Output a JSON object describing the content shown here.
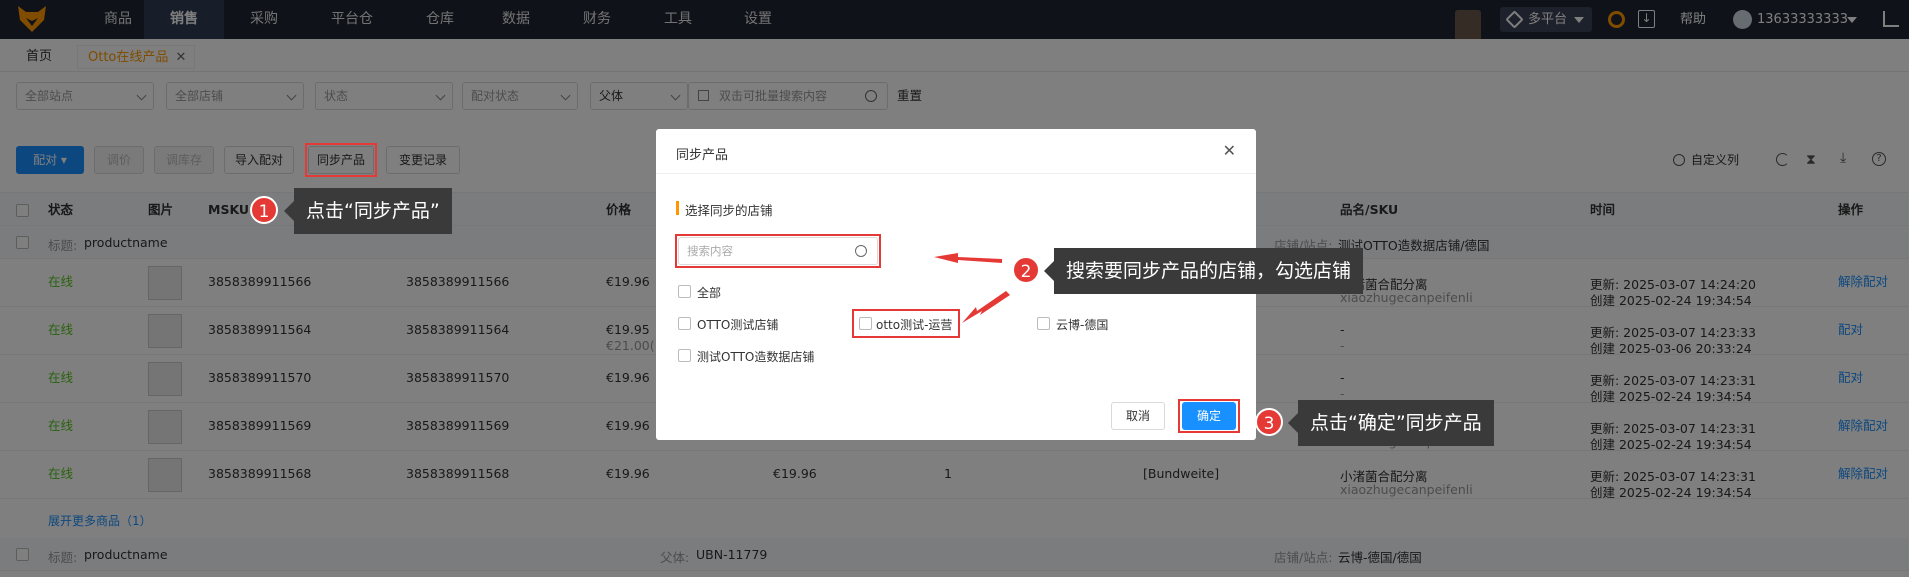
{
  "nav": {
    "items": [
      "商品",
      "销售",
      "采购",
      "平台仓",
      "仓库",
      "数据",
      "财务",
      "工具",
      "设置"
    ],
    "active": "销售",
    "platform": "多平台",
    "help": "帮助",
    "user": "13633333333"
  },
  "tabs": {
    "home": "首页",
    "current": "Otto在线产品"
  },
  "filters": {
    "site": "全部站点",
    "shop": "全部店铺",
    "status": "状态",
    "pair_status": "配对状态",
    "parent": "父体",
    "search_placeholder": "双击可批量搜索内容",
    "reset": "重置"
  },
  "toolbar": {
    "pair": "配对",
    "adjust_price": "调价",
    "adjust_stock": "调库存",
    "import_pair": "导入配对",
    "sync": "同步产品",
    "change_log": "变更记录",
    "custom_columns": "自定义列"
  },
  "columns": {
    "status": "状态",
    "image": "图片",
    "msku": "MSKU",
    "price": "价格",
    "product_sku": "品名/SKU",
    "time": "时间",
    "action": "操作"
  },
  "group1": {
    "label": "标题:",
    "name": "productname",
    "store_label": "店铺/站点:",
    "store": "测试OTTO造数据店铺/德国"
  },
  "rows": [
    {
      "status": "在线",
      "msku": "3858389911566",
      "sku2": "3858389911566",
      "price": "€19.96",
      "price2": "",
      "name": "小渚菌合配分离",
      "sub": "xiaozhugecanpeifenli",
      "update": "更新:  2025-03-07 14:24:20",
      "create": "创建  2025-02-24 19:34:54",
      "action": "解除配对"
    },
    {
      "status": "在线",
      "msku": "3858389911564",
      "sku2": "3858389911564",
      "price": "€19.95",
      "price2": "€21.00(",
      "name": "-",
      "sub": "-",
      "update": "更新:  2025-03-07 14:23:33",
      "create": "创建  2025-03-06 20:33:24",
      "action": "配对"
    },
    {
      "status": "在线",
      "msku": "3858389911570",
      "sku2": "3858389911570",
      "price": "€19.96",
      "price2": "",
      "name": "-",
      "sub": "-",
      "update": "更新:  2025-03-07 14:23:31",
      "create": "创建  2025-02-24 19:34:54",
      "action": "配对"
    },
    {
      "status": "在线",
      "msku": "3858389911569",
      "sku2": "3858389911569",
      "price": "€19.96",
      "price2": "",
      "name": "小渚菌合配分离",
      "sub": "xiaozhugecanpeifenli",
      "update": "更新:  2025-03-07 14:23:31",
      "create": "创建  2025-02-24 19:34:54",
      "action": "解除配对"
    },
    {
      "status": "在线",
      "msku": "3858389911568",
      "sku2": "3858389911568",
      "price": "€19.96",
      "price2": "",
      "name": "小渚菌合配分离",
      "sub": "xiaozhugecanpeifenli",
      "update": "更新:  2025-03-07 14:23:31",
      "create": "创建  2025-02-24 19:34:54",
      "action": "解除配对",
      "extra_price": "€19.96",
      "qty": "1",
      "bund": "[Bundweite]"
    }
  ],
  "expand_more": "展开更多商品（1）",
  "group2": {
    "label": "标题:",
    "name": "productname",
    "parent_label": "父体:",
    "parent": "UBN-11779",
    "store_label": "店铺/站点:",
    "store": "云博-德国/德国"
  },
  "modal": {
    "title": "同步产品",
    "section": "选择同步的店铺",
    "search_placeholder": "搜索内容",
    "all": "全部",
    "stores": [
      "OTTO测试店铺",
      "otto测试-运营",
      "云博-德国",
      "测试OTTO造数据店铺"
    ],
    "cancel": "取消",
    "confirm": "确定"
  },
  "callouts": {
    "n1": "1",
    "c1": "点击“同步产品”",
    "n2": "2",
    "c2": "搜索要同步产品的店铺，勾选店铺",
    "n3": "3",
    "c3": "点击“确定”同步产品"
  },
  "colors": {
    "nav_bg": "#1f2533",
    "primary": "#1890ff",
    "online": "#52c41a",
    "highlight": "#e53935",
    "tab_active": "#ff9800"
  }
}
